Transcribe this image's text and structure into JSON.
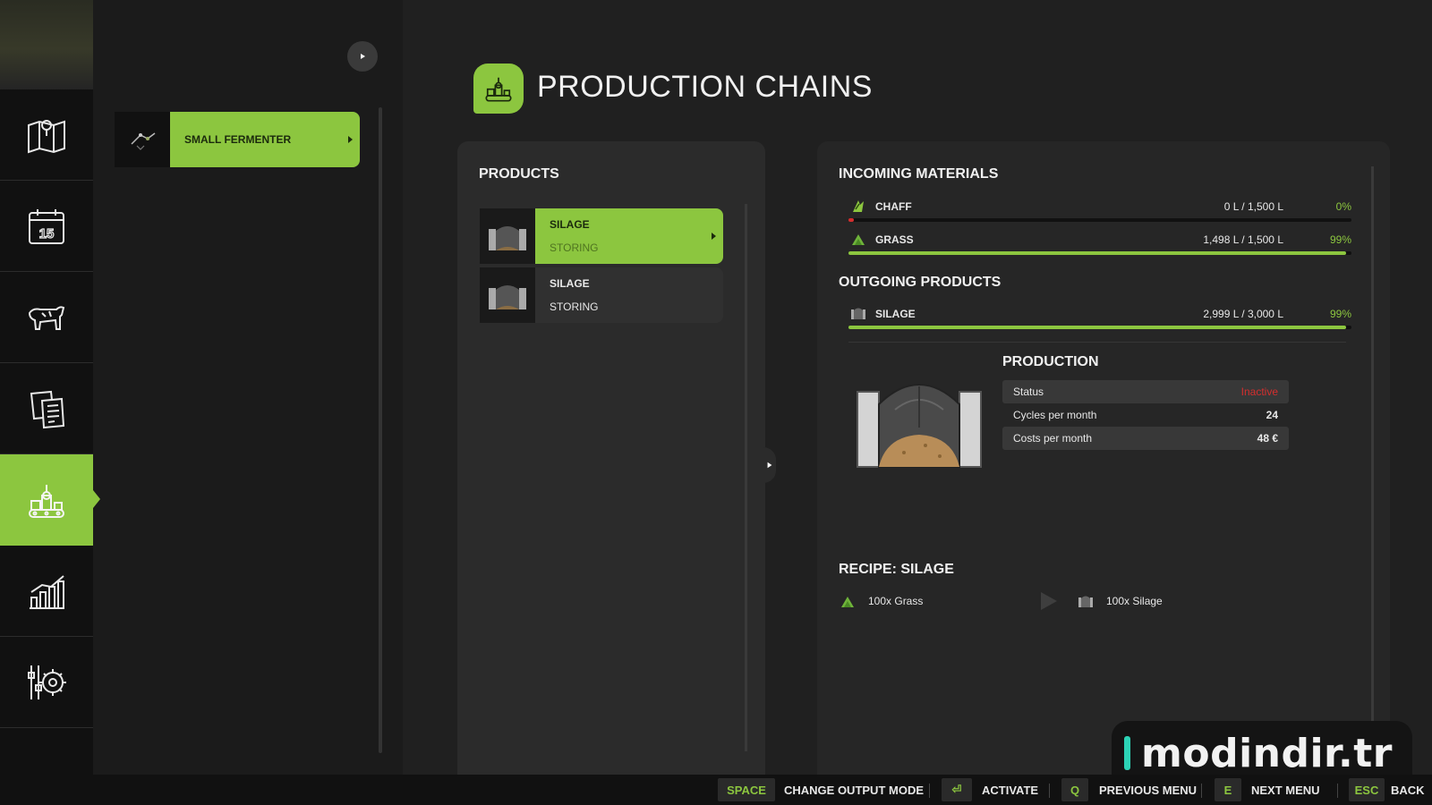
{
  "header": {
    "title": "PRODUCTION CHAINS",
    "icon": "production-chains-icon"
  },
  "nav": {
    "items": [
      {
        "name": "map",
        "icon": "map-icon"
      },
      {
        "name": "calendar",
        "icon": "calendar-icon",
        "badge": "15"
      },
      {
        "name": "animals",
        "icon": "cow-icon"
      },
      {
        "name": "contracts",
        "icon": "documents-icon"
      },
      {
        "name": "production",
        "icon": "production-chains-icon",
        "active": true
      },
      {
        "name": "statistics",
        "icon": "bar-chart-icon"
      },
      {
        "name": "settings",
        "icon": "settings-gear-icon"
      }
    ]
  },
  "list": {
    "entries": [
      {
        "label": "SMALL FERMENTER",
        "selected": true
      }
    ]
  },
  "products": {
    "title": "PRODUCTS",
    "items": [
      {
        "name": "SILAGE",
        "mode": "STORING",
        "selected": true
      },
      {
        "name": "SILAGE",
        "mode": "STORING",
        "selected": false
      }
    ]
  },
  "incoming": {
    "title": "INCOMING MATERIALS",
    "items": [
      {
        "name": "CHAFF",
        "amount": "0 L / 1,500 L",
        "percent": "0%",
        "fill": 0.0,
        "icon": "chaff-icon"
      },
      {
        "name": "GRASS",
        "amount": "1,498 L / 1,500 L",
        "percent": "99%",
        "fill": 0.99,
        "icon": "grass-icon"
      }
    ]
  },
  "outgoing": {
    "title": "OUTGOING PRODUCTS",
    "items": [
      {
        "name": "SILAGE",
        "amount": "2,999 L / 3,000 L",
        "percent": "99%",
        "fill": 0.99,
        "icon": "silage-icon"
      }
    ]
  },
  "production": {
    "title": "PRODUCTION",
    "stats": [
      {
        "label": "Status",
        "value": "Inactive"
      },
      {
        "label": "Cycles per month",
        "value": "24"
      },
      {
        "label": "Costs per month",
        "value": "48 €"
      }
    ]
  },
  "recipe": {
    "title": "RECIPE: SILAGE",
    "input": "100x Grass",
    "output": "100x Silage"
  },
  "actions": [
    {
      "key": "SPACE",
      "label": "CHANGE OUTPUT MODE"
    },
    {
      "key": "⏎",
      "label": "ACTIVATE"
    },
    {
      "key": "Q",
      "label": "PREVIOUS MENU"
    },
    {
      "key": "E",
      "label": "NEXT MENU"
    },
    {
      "key": "ESC",
      "label": "BACK"
    }
  ],
  "watermark": "modindir.tr",
  "colors": {
    "accent": "#8cc63f",
    "inactive": "#d42e2e",
    "background": "#202020"
  }
}
